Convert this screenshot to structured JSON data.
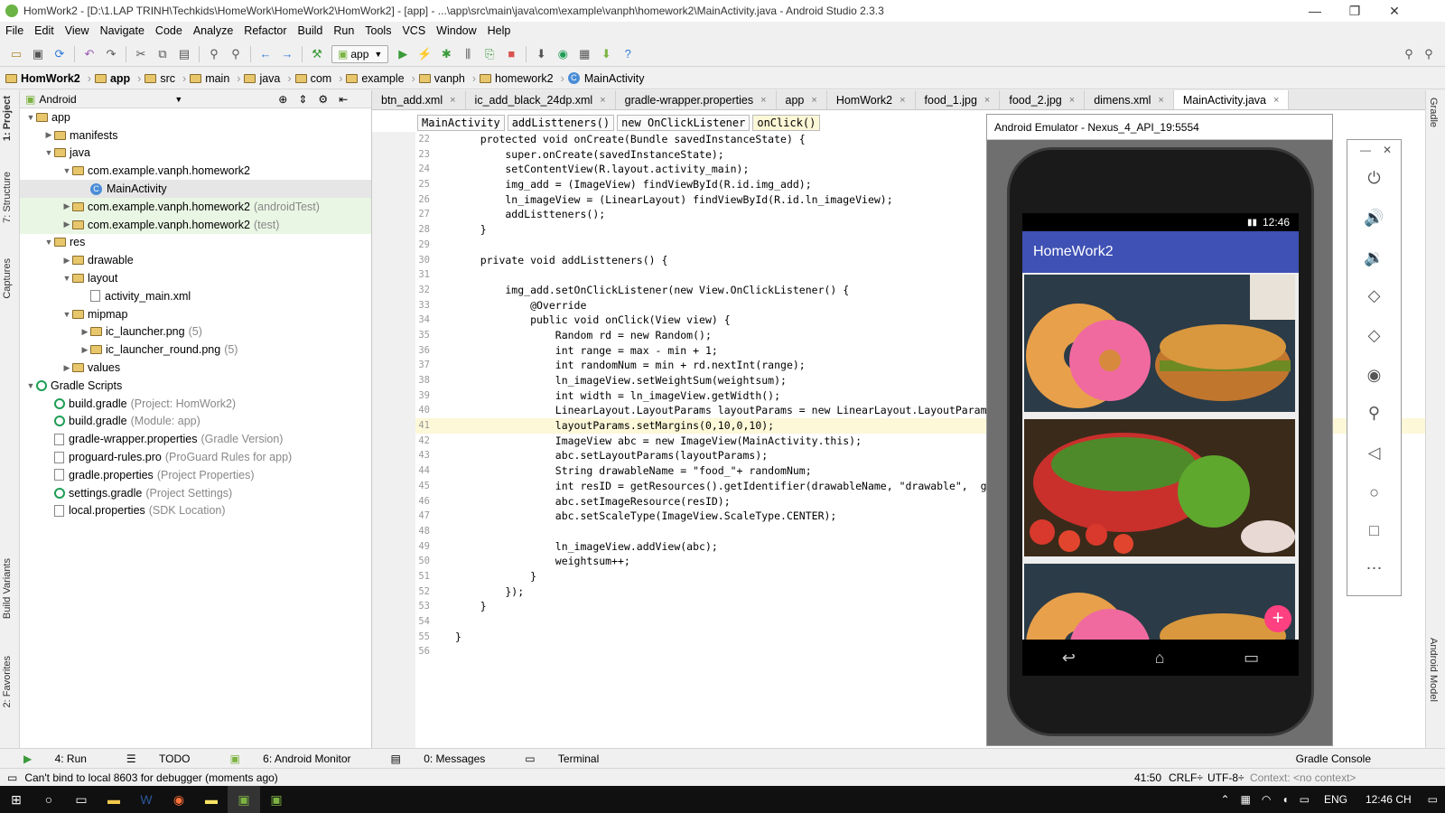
{
  "window": {
    "title": "HomWork2 - [D:\\1.LAP TRINH\\Techkids\\HomeWork\\HomeWork2\\HomWork2] - [app] - ...\\app\\src\\main\\java\\com\\example\\vanph\\homework2\\MainActivity.java - Android Studio 2.3.3"
  },
  "menu": [
    "File",
    "Edit",
    "View",
    "Navigate",
    "Code",
    "Analyze",
    "Refactor",
    "Build",
    "Run",
    "Tools",
    "VCS",
    "Window",
    "Help"
  ],
  "toolbar": {
    "run_config": "app"
  },
  "breadcrumb": [
    "HomWork2",
    "app",
    "src",
    "main",
    "java",
    "com",
    "example",
    "vanph",
    "homework2",
    "MainActivity"
  ],
  "project": {
    "view_label": "Android",
    "tree": [
      {
        "label": "app",
        "note": "",
        "depth": 0,
        "arrow": "▼",
        "kind": "folder"
      },
      {
        "label": "manifests",
        "note": "",
        "depth": 1,
        "arrow": "▶",
        "kind": "folder"
      },
      {
        "label": "java",
        "note": "",
        "depth": 1,
        "arrow": "▼",
        "kind": "folder"
      },
      {
        "label": "com.example.vanph.homework2",
        "note": "",
        "depth": 2,
        "arrow": "▼",
        "kind": "folder"
      },
      {
        "label": "MainActivity",
        "note": "",
        "depth": 3,
        "arrow": "",
        "kind": "class",
        "selected": true
      },
      {
        "label": "com.example.vanph.homework2",
        "note": "(androidTest)",
        "depth": 2,
        "arrow": "▶",
        "kind": "folder",
        "test": true
      },
      {
        "label": "com.example.vanph.homework2",
        "note": "(test)",
        "depth": 2,
        "arrow": "▶",
        "kind": "folder",
        "test": true
      },
      {
        "label": "res",
        "note": "",
        "depth": 1,
        "arrow": "▼",
        "kind": "folder"
      },
      {
        "label": "drawable",
        "note": "",
        "depth": 2,
        "arrow": "▶",
        "kind": "folder"
      },
      {
        "label": "layout",
        "note": "",
        "depth": 2,
        "arrow": "▼",
        "kind": "folder"
      },
      {
        "label": "activity_main.xml",
        "note": "",
        "depth": 3,
        "arrow": "",
        "kind": "file"
      },
      {
        "label": "mipmap",
        "note": "",
        "depth": 2,
        "arrow": "▼",
        "kind": "folder"
      },
      {
        "label": "ic_launcher.png",
        "note": "(5)",
        "depth": 3,
        "arrow": "▶",
        "kind": "folder"
      },
      {
        "label": "ic_launcher_round.png",
        "note": "(5)",
        "depth": 3,
        "arrow": "▶",
        "kind": "folder"
      },
      {
        "label": "values",
        "note": "",
        "depth": 2,
        "arrow": "▶",
        "kind": "folder"
      },
      {
        "label": "Gradle Scripts",
        "note": "",
        "depth": 0,
        "arrow": "▼",
        "kind": "gradle"
      },
      {
        "label": "build.gradle",
        "note": "(Project: HomWork2)",
        "depth": 1,
        "arrow": "",
        "kind": "gradle"
      },
      {
        "label": "build.gradle",
        "note": "(Module: app)",
        "depth": 1,
        "arrow": "",
        "kind": "gradle"
      },
      {
        "label": "gradle-wrapper.properties",
        "note": "(Gradle Version)",
        "depth": 1,
        "arrow": "",
        "kind": "file"
      },
      {
        "label": "proguard-rules.pro",
        "note": "(ProGuard Rules for app)",
        "depth": 1,
        "arrow": "",
        "kind": "file"
      },
      {
        "label": "gradle.properties",
        "note": "(Project Properties)",
        "depth": 1,
        "arrow": "",
        "kind": "file"
      },
      {
        "label": "settings.gradle",
        "note": "(Project Settings)",
        "depth": 1,
        "arrow": "",
        "kind": "gradle"
      },
      {
        "label": "local.properties",
        "note": "(SDK Location)",
        "depth": 1,
        "arrow": "",
        "kind": "file"
      }
    ]
  },
  "editor": {
    "tabs": [
      "btn_add.xml",
      "ic_add_black_24dp.xml",
      "gradle-wrapper.properties",
      "app",
      "HomWork2",
      "food_1.jpg",
      "food_2.jpg",
      "dimens.xml",
      "MainActivity.java"
    ],
    "active_tab": "MainActivity.java",
    "code_crumbs": [
      "MainActivity",
      "addListteners()",
      "new OnClickListener",
      "onClick()"
    ],
    "lines": [
      {
        "n": "22",
        "t": "    protected void onCreate(Bundle savedInstanceState) {"
      },
      {
        "n": "23",
        "t": "        super.onCreate(savedInstanceState);"
      },
      {
        "n": "24",
        "t": "        setContentView(R.layout.activity_main);"
      },
      {
        "n": "25",
        "t": "        img_add = (ImageView) findViewById(R.id.img_add);"
      },
      {
        "n": "26",
        "t": "        ln_imageView = (LinearLayout) findViewById(R.id.ln_imageView);"
      },
      {
        "n": "27",
        "t": "        addListteners();"
      },
      {
        "n": "28",
        "t": "    }"
      },
      {
        "n": "29",
        "t": ""
      },
      {
        "n": "30",
        "t": "    private void addListteners() {"
      },
      {
        "n": "31",
        "t": ""
      },
      {
        "n": "32",
        "t": "        img_add.setOnClickListener(new View.OnClickListener() {"
      },
      {
        "n": "33",
        "t": "            @Override"
      },
      {
        "n": "34",
        "t": "            public void onClick(View view) {"
      },
      {
        "n": "35",
        "t": "                Random rd = new Random();"
      },
      {
        "n": "36",
        "t": "                int range = max - min + 1;"
      },
      {
        "n": "37",
        "t": "                int randomNum = min + rd.nextInt(range);"
      },
      {
        "n": "38",
        "t": "                ln_imageView.setWeightSum(weightsum);"
      },
      {
        "n": "39",
        "t": "                int width = ln_imageView.getWidth();"
      },
      {
        "n": "40",
        "t": "                LinearLayout.LayoutParams layoutParams = new LinearLayout.LayoutParams(width"
      },
      {
        "n": "41",
        "t": "                layoutParams.setMargins(0,10,0,10);"
      },
      {
        "n": "42",
        "t": "                ImageView abc = new ImageView(MainActivity.this);"
      },
      {
        "n": "43",
        "t": "                abc.setLayoutParams(layoutParams);"
      },
      {
        "n": "44",
        "t": "                String drawableName = \"food_\"+ randomNum;"
      },
      {
        "n": "45",
        "t": "                int resID = getResources().getIdentifier(drawableName, \"drawable\",  getPacka"
      },
      {
        "n": "46",
        "t": "                abc.setImageResource(resID);"
      },
      {
        "n": "47",
        "t": "                abc.setScaleType(ImageView.ScaleType.CENTER);"
      },
      {
        "n": "48",
        "t": ""
      },
      {
        "n": "49",
        "t": "                ln_imageView.addView(abc);"
      },
      {
        "n": "50",
        "t": "                weightsum++;"
      },
      {
        "n": "51",
        "t": "            }"
      },
      {
        "n": "52",
        "t": "        });"
      },
      {
        "n": "53",
        "t": "    }"
      },
      {
        "n": "54",
        "t": ""
      },
      {
        "n": "55",
        "t": "}"
      },
      {
        "n": "56",
        "t": ""
      }
    ],
    "highlight_line": "41"
  },
  "emulator": {
    "title": "Android Emulator - Nexus_4_API_19:5554",
    "clock": "12:46",
    "app_title": "HomeWork2",
    "fab": "+"
  },
  "left_tabs": [
    "1: Project",
    "7: Structure",
    "Captures",
    "Build Variants",
    "2: Favorites"
  ],
  "right_tabs": [
    "Gradle",
    "Android Model"
  ],
  "bottom_tabs": [
    "4: Run",
    "TODO",
    "6: Android Monitor",
    "0: Messages",
    "Terminal",
    "Gradle Console"
  ],
  "status": {
    "message": "Can't bind to local 8603 for debugger (moments ago)",
    "position": "41:50",
    "line_sep": "CRLF÷",
    "encoding": "UTF-8÷",
    "context": "Context: <no context>"
  },
  "taskbar": {
    "lang": "ENG",
    "time": "12:46 CH"
  },
  "colors": {
    "app_bar": "#3f51b5",
    "fab": "#ff4081",
    "selection": "#e6e6e6"
  }
}
